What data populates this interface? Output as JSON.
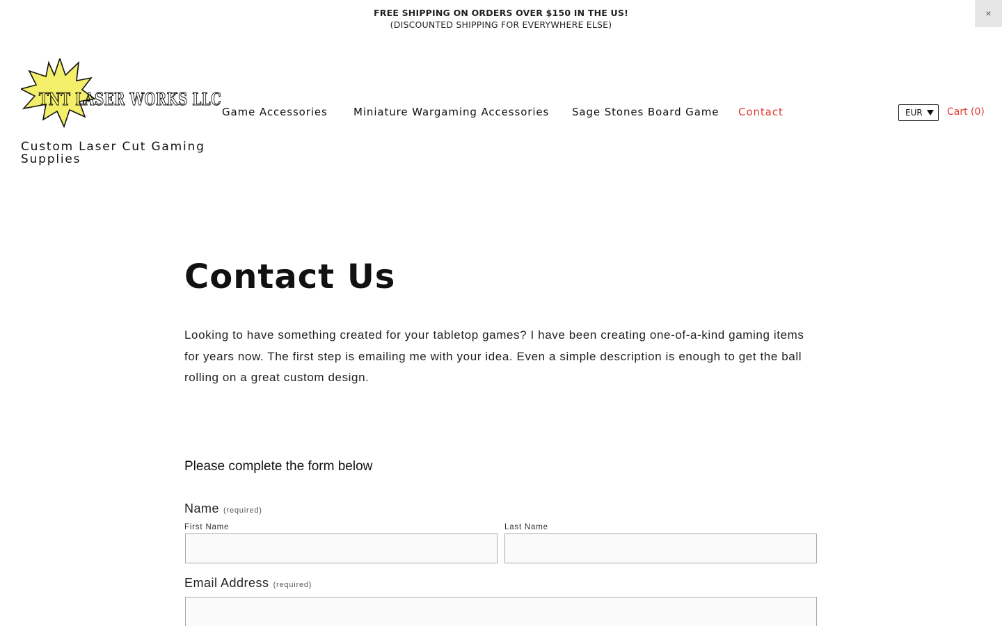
{
  "announcement": {
    "line1": "FREE SHIPPING ON ORDERS OVER $150 IN THE US!",
    "line2": "(DISCOUNTED SHIPPING FOR EVERYWHERE ELSE)",
    "close_label": "×"
  },
  "header": {
    "logo_text": "TNT LASER WORKS LLC",
    "tagline": "Custom Laser Cut Gaming Supplies",
    "nav": [
      {
        "label": "Game Accessories"
      },
      {
        "label": "Miniature Wargaming Accessories"
      },
      {
        "label": "Sage Stones Board Game"
      },
      {
        "label": "Contact",
        "active": true
      }
    ],
    "currency": "EUR",
    "cart_label": "Cart (0)"
  },
  "main": {
    "title": "Contact Us",
    "intro": "Looking to have something created for your tabletop games? I have been creating one-of-a-kind gaming items for years now. The first step is emailing me with your idea. Even a simple description is enough to get the ball rolling on a great custom design.",
    "form": {
      "heading": "Please complete the form below",
      "name_label": "Name",
      "required_note": "(required)",
      "first_name_label": "First Name",
      "first_name_value": "",
      "last_name_label": "Last Name",
      "last_name_value": "",
      "email_label": "Email Address",
      "email_value": ""
    }
  },
  "colors": {
    "accent": "#e03a2f",
    "logo_star": "#f4ef6a",
    "text": "#111111"
  },
  "icons": {
    "close": "close-icon",
    "currency_caret": "caret-down-icon"
  }
}
